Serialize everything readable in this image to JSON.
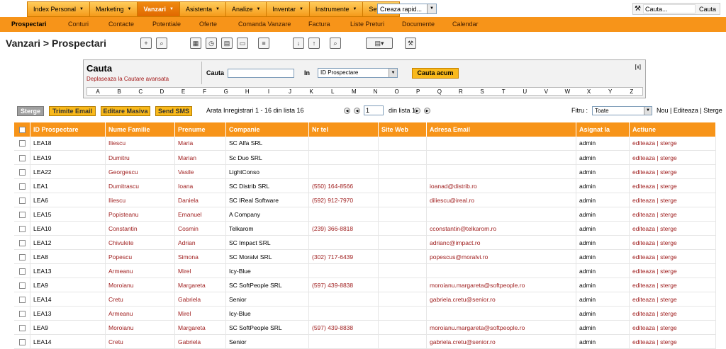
{
  "menus": [
    {
      "label": "Index Personal",
      "active": false
    },
    {
      "label": "Marketing",
      "active": false
    },
    {
      "label": "Vanzari",
      "active": true
    },
    {
      "label": "Asistenta",
      "active": false
    },
    {
      "label": "Analize",
      "active": false
    },
    {
      "label": "Inventar",
      "active": false
    },
    {
      "label": "Instrumente",
      "active": false
    },
    {
      "label": "Setari",
      "active": false
    }
  ],
  "quick_create": "Creaza rapid...",
  "search": {
    "placeholder": "Cauta...",
    "button": "Cauta"
  },
  "subnav": [
    "Prospectari",
    "Conturi",
    "Contacte",
    "Potentiale",
    "Oferte",
    "Comanda Vanzare",
    "Factura",
    "Liste Preturi",
    "Documente",
    "Calendar"
  ],
  "page_title": "Vanzari > Prospectari",
  "search_panel": {
    "title": "Cauta",
    "advanced_link": "Deplaseaza la Cautare avansata",
    "search_label": "Cauta",
    "in_label": "In",
    "in_value": "ID Prospectare",
    "button": "Cauta acum",
    "close": "[x]",
    "letters": [
      "A",
      "B",
      "C",
      "D",
      "E",
      "F",
      "G",
      "H",
      "I",
      "J",
      "K",
      "L",
      "M",
      "N",
      "O",
      "P",
      "Q",
      "R",
      "S",
      "T",
      "U",
      "V",
      "W",
      "X",
      "Y",
      "Z"
    ]
  },
  "actions": {
    "delete": "Sterge",
    "email": "Trimite Email",
    "mass_edit": "Editare Masiva",
    "sms": "Send SMS"
  },
  "pagination": {
    "records": "Arata Inregistrari 1 - 16 din lista 16",
    "page": "1",
    "of": "din lista 1"
  },
  "filter": {
    "label": "Fitru :",
    "value": "Toate",
    "links": "Nou | Editeaza | Sterge"
  },
  "table": {
    "headers": [
      "ID Prospectare",
      "Nume Familie",
      "Prenume",
      "Companie",
      "Nr tel",
      "Site Web",
      "Adresa Email",
      "Asignat la",
      "Actiune"
    ],
    "rows": [
      [
        "LEA18",
        "Iliescu",
        "Maria",
        "SC Alfa SRL",
        "",
        "",
        "",
        "admin",
        "editeaza | sterge"
      ],
      [
        "LEA19",
        "Dumitru",
        "Marian",
        "Sc Duo SRL",
        "",
        "",
        "",
        "admin",
        "editeaza | sterge"
      ],
      [
        "LEA22",
        "Georgescu",
        "Vasile",
        "LightConso",
        "",
        "",
        "",
        "admin",
        "editeaza | sterge"
      ],
      [
        "LEA1",
        "Dumitrascu",
        "Ioana",
        "SC Distrib SRL",
        "(550) 164-8566",
        "",
        "ioanad@distrib.ro",
        "admin",
        "editeaza | sterge"
      ],
      [
        "LEA6",
        "Iliescu",
        "Daniela",
        "SC IReal Software",
        "(592) 912-7970",
        "",
        "diliescu@ireal.ro",
        "admin",
        "editeaza | sterge"
      ],
      [
        "LEA15",
        "Popisteanu",
        "Emanuel",
        "A Company",
        "",
        "",
        "",
        "admin",
        "editeaza | sterge"
      ],
      [
        "LEA10",
        "Constantin",
        "Cosmin",
        "Telkarom",
        "(239) 366-8818",
        "",
        "cconstantin@telkarom.ro",
        "admin",
        "editeaza | sterge"
      ],
      [
        "LEA12",
        "Chivulete",
        "Adrian",
        "SC Impact SRL",
        "",
        "",
        "adrianc@impact.ro",
        "admin",
        "editeaza | sterge"
      ],
      [
        "LEA8",
        "Popescu",
        "Simona",
        "SC Moralvi SRL",
        "(302) 717-6439",
        "",
        "popescus@moralvi.ro",
        "admin",
        "editeaza | sterge"
      ],
      [
        "LEA13",
        "Armeanu",
        "Mirel",
        "Icy-Blue",
        "",
        "",
        "",
        "admin",
        "editeaza | sterge"
      ],
      [
        "LEA9",
        "Moroianu",
        "Margareta",
        "SC SoftPeople SRL",
        "(597) 439-8838",
        "",
        "moroianu.margareta@softpeople.ro",
        "admin",
        "editeaza | sterge"
      ],
      [
        "LEA14",
        "Cretu",
        "Gabriela",
        "Senior",
        "",
        "",
        "gabriela.cretu@senior.ro",
        "admin",
        "editeaza | sterge"
      ],
      [
        "LEA13",
        "Armeanu",
        "Mirel",
        "Icy-Blue",
        "",
        "",
        "",
        "admin",
        "editeaza | sterge"
      ],
      [
        "LEA9",
        "Moroianu",
        "Margareta",
        "SC SoftPeople SRL",
        "(597) 439-8838",
        "",
        "moroianu.margareta@softpeople.ro",
        "admin",
        "editeaza | sterge"
      ],
      [
        "LEA14",
        "Cretu",
        "Gabriela",
        "Senior",
        "",
        "",
        "gabriela.cretu@senior.ro",
        "admin",
        "editeaza | sterge"
      ]
    ]
  },
  "colors": {
    "accent": "#f79419",
    "link": "#a02020",
    "active_menu": "#e06800"
  }
}
